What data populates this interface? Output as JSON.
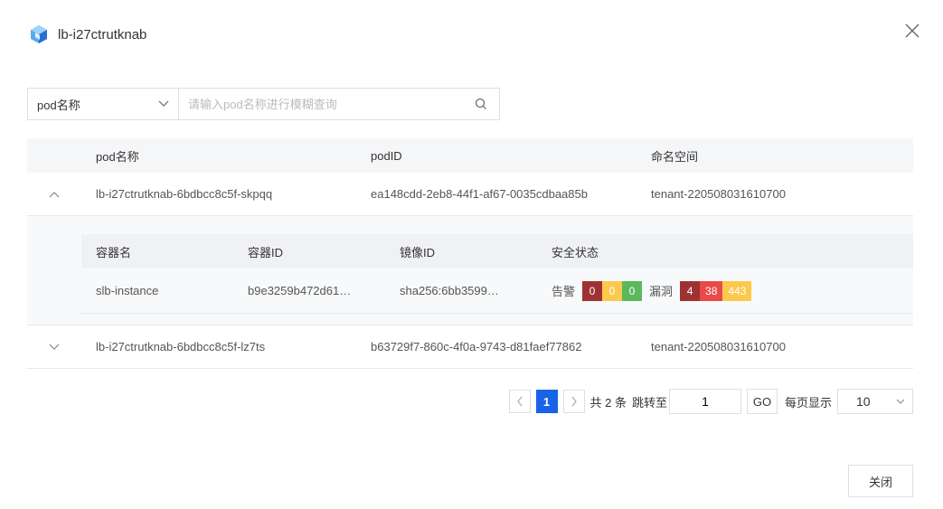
{
  "header": {
    "title": "lb-i27ctrutknab"
  },
  "filter": {
    "select_value": "pod名称",
    "placeholder": "请输入pod名称进行模糊查询"
  },
  "table": {
    "columns": [
      "pod名称",
      "podID",
      "命名空间"
    ],
    "rows": [
      {
        "name": "lb-i27ctrutknab-6bdbcc8c5f-skpqq",
        "id": "ea148cdd-2eb8-44f1-af67-0035cdbaa85b",
        "namespace": "tenant-220508031610700"
      },
      {
        "name": "lb-i27ctrutknab-6bdbcc8c5f-lz7ts",
        "id": "b63729f7-860c-4f0a-9743-d81faef77862",
        "namespace": "tenant-220508031610700"
      }
    ],
    "inner": {
      "columns": [
        "容器名",
        "容器ID",
        "镜像ID",
        "安全状态"
      ],
      "row": {
        "container": "slb-instance",
        "container_id": "b9e3259b472d61…",
        "image_id": "sha256:6bb3599…",
        "alarm_label": "告警",
        "alarm_counts": [
          "0",
          "0",
          "0"
        ],
        "vuln_label": "漏洞",
        "vuln_counts": [
          "4",
          "38",
          "443"
        ]
      }
    }
  },
  "pagination": {
    "current": "1",
    "total": "共 2 条",
    "jump_label": "跳转至",
    "jump_value": "1",
    "go": "GO",
    "size_label": "每页显示",
    "size_value": "10"
  },
  "footer": {
    "close_label": "关闭"
  },
  "colors": {
    "primary": "#1a62e8",
    "darkred": "#9e3232",
    "red": "#e84a4a",
    "yellow": "#fcc94d",
    "green": "#5cb85c"
  }
}
